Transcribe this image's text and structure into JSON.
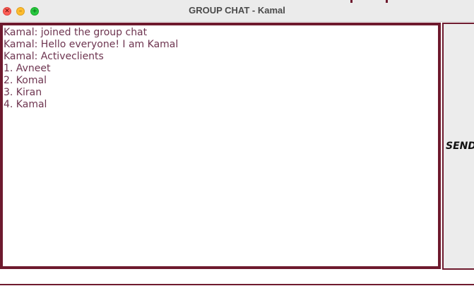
{
  "window": {
    "title": "GROUP CHAT - Kamal"
  },
  "chat": {
    "messages": [
      "Kamal: joined the group chat",
      "Kamal: Hello everyone! I am Kamal",
      "Kamal: Activeclients",
      "1. Avneet",
      "2. Komal",
      "3. Kiran",
      "4. Kamal"
    ]
  },
  "send_button": {
    "label": "SEND"
  },
  "input": {
    "value": ""
  },
  "colors": {
    "accent": "#6e1a2e",
    "text": "#6e3550",
    "titlebar": "#ebebeb"
  }
}
